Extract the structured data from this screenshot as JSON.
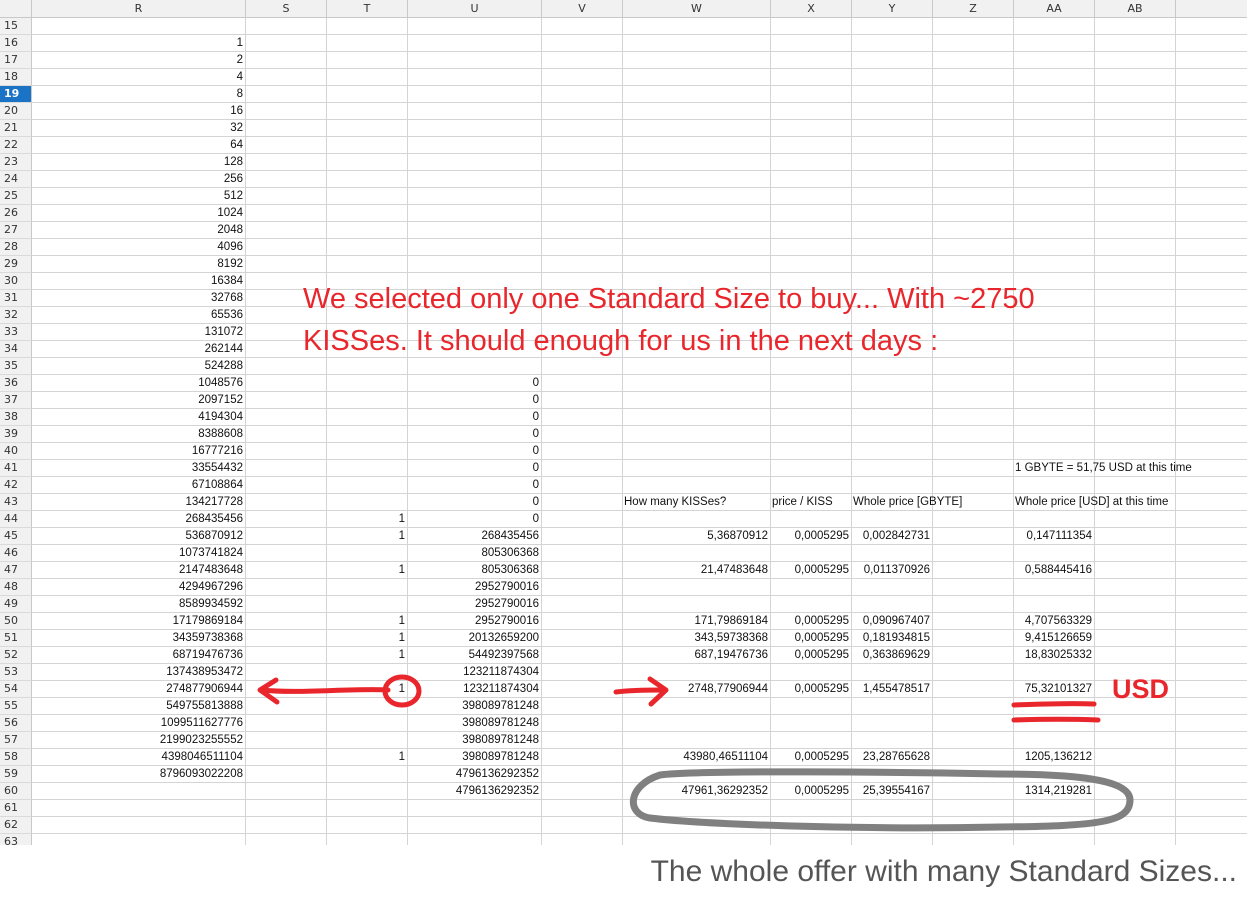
{
  "columns": [
    "R",
    "S",
    "T",
    "U",
    "V",
    "W",
    "X",
    "Y",
    "Z",
    "AA",
    "AB"
  ],
  "selected_row": "19",
  "rows": [
    {
      "n": "15",
      "R": "",
      "T": "",
      "U": "",
      "W": "",
      "X": "",
      "Y": "",
      "AA": ""
    },
    {
      "n": "16",
      "R": "1"
    },
    {
      "n": "17",
      "R": "2"
    },
    {
      "n": "18",
      "R": "4"
    },
    {
      "n": "19",
      "R": "8"
    },
    {
      "n": "20",
      "R": "16"
    },
    {
      "n": "21",
      "R": "32"
    },
    {
      "n": "22",
      "R": "64"
    },
    {
      "n": "23",
      "R": "128"
    },
    {
      "n": "24",
      "R": "256"
    },
    {
      "n": "25",
      "R": "512"
    },
    {
      "n": "26",
      "R": "1024"
    },
    {
      "n": "27",
      "R": "2048"
    },
    {
      "n": "28",
      "R": "4096"
    },
    {
      "n": "29",
      "R": "8192"
    },
    {
      "n": "30",
      "R": "16384"
    },
    {
      "n": "31",
      "R": "32768"
    },
    {
      "n": "32",
      "R": "65536"
    },
    {
      "n": "33",
      "R": "131072"
    },
    {
      "n": "34",
      "R": "262144"
    },
    {
      "n": "35",
      "R": "524288"
    },
    {
      "n": "36",
      "R": "1048576",
      "U": "0"
    },
    {
      "n": "37",
      "R": "2097152",
      "U": "0"
    },
    {
      "n": "38",
      "R": "4194304",
      "U": "0"
    },
    {
      "n": "39",
      "R": "8388608",
      "U": "0"
    },
    {
      "n": "40",
      "R": "16777216",
      "U": "0"
    },
    {
      "n": "41",
      "R": "33554432",
      "U": "0",
      "AA_text": "1 GBYTE = 51,75 USD at this time"
    },
    {
      "n": "42",
      "R": "67108864",
      "U": "0"
    },
    {
      "n": "43",
      "R": "134217728",
      "U": "0",
      "W_text": "How many KISSes?",
      "X_text": "price / KISS",
      "Y_text": "Whole price [GBYTE]",
      "AA_text": "Whole price [USD] at this time"
    },
    {
      "n": "44",
      "R": "268435456",
      "T": "1",
      "U": "0"
    },
    {
      "n": "45",
      "R": "536870912",
      "T": "1",
      "U": "268435456",
      "W": "5,36870912",
      "X": "0,0005295",
      "Y": "0,002842731",
      "AA": "0,147111354"
    },
    {
      "n": "46",
      "R": "1073741824",
      "U": "805306368"
    },
    {
      "n": "47",
      "R": "2147483648",
      "T": "1",
      "U": "805306368",
      "W": "21,47483648",
      "X": "0,0005295",
      "Y": "0,011370926",
      "AA": "0,588445416"
    },
    {
      "n": "48",
      "R": "4294967296",
      "U": "2952790016"
    },
    {
      "n": "49",
      "R": "8589934592",
      "U": "2952790016"
    },
    {
      "n": "50",
      "R": "17179869184",
      "T": "1",
      "U": "2952790016",
      "W": "171,79869184",
      "X": "0,0005295",
      "Y": "0,090967407",
      "AA": "4,707563329"
    },
    {
      "n": "51",
      "R": "34359738368",
      "T": "1",
      "U": "20132659200",
      "W": "343,59738368",
      "X": "0,0005295",
      "Y": "0,181934815",
      "AA": "9,415126659"
    },
    {
      "n": "52",
      "R": "68719476736",
      "T": "1",
      "U": "54492397568",
      "W": "687,19476736",
      "X": "0,0005295",
      "Y": "0,363869629",
      "AA": "18,83025332"
    },
    {
      "n": "53",
      "R": "137438953472",
      "U": "123211874304"
    },
    {
      "n": "54",
      "R": "274877906944",
      "T": "1",
      "U": "123211874304",
      "W": "2748,77906944",
      "X": "0,0005295",
      "Y": "1,455478517",
      "AA": "75,32101327"
    },
    {
      "n": "55",
      "R": "549755813888",
      "U": "398089781248"
    },
    {
      "n": "56",
      "R": "1099511627776",
      "U": "398089781248"
    },
    {
      "n": "57",
      "R": "2199023255552",
      "U": "398089781248"
    },
    {
      "n": "58",
      "R": "4398046511104",
      "T": "1",
      "U": "398089781248",
      "W": "43980,46511104",
      "X": "0,0005295",
      "Y": "23,28765628",
      "AA": "1205,136212"
    },
    {
      "n": "59",
      "R": "8796093022208",
      "U": "4796136292352"
    },
    {
      "n": "60",
      "U": "4796136292352",
      "W": "47961,36292352",
      "X": "0,0005295",
      "Y": "25,39554167",
      "AA": "1314,219281"
    },
    {
      "n": "61"
    },
    {
      "n": "62"
    },
    {
      "n": "63"
    }
  ],
  "annotations": {
    "note_line1": "We selected only one Standard Size to buy... With ~2750",
    "note_line2": "KISSes. It should enough for us in the next days :",
    "usd_label": "USD",
    "caption": "The whole offer with many Standard Sizes...",
    "accent_color": "#e8262c",
    "circle_color": "#808080"
  }
}
